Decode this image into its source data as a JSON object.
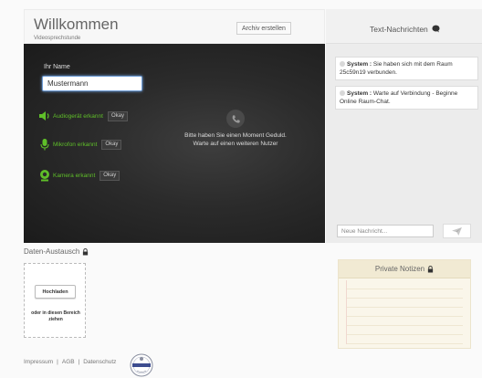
{
  "header": {
    "title": "Willkommen",
    "subtitle": "Videosprechstunde",
    "archive_label": "Archiv erstellen"
  },
  "setup": {
    "name_label": "Ihr Name",
    "name_value": "Mustermann",
    "checks": [
      {
        "icon": "speaker-icon",
        "label": "Audiogerät erkannt",
        "button": "Okay"
      },
      {
        "icon": "microphone-icon",
        "label": "Mikrofon erkannt",
        "button": "Okay"
      },
      {
        "icon": "webcam-icon",
        "label": "Kamera erkannt",
        "button": "Okay"
      }
    ],
    "wait_line1": "Bitte haben Sie einen Moment Geduld.",
    "wait_line2": "Warte auf einen weiteren Nutzer"
  },
  "chat": {
    "title": "Text-Nachrichten",
    "messages": [
      {
        "sender": "System :",
        "text": " Sie haben sich mit dem Raum 25c59n19 verbunden."
      },
      {
        "sender": "System :",
        "text": " Warte auf Verbindung - Beginne Online Raum-Chat."
      }
    ],
    "input_placeholder": "Neue Nachricht..."
  },
  "data_exchange": {
    "title": "Daten-Austausch",
    "upload_label": "Hochladen",
    "drop_text": "oder in diesen Bereich ziehen"
  },
  "notes": {
    "title": "Private Notizen"
  },
  "footer": {
    "links": [
      "Impressum",
      "AGB",
      "Datenschutz"
    ],
    "separator": "|"
  },
  "colors": {
    "accent_green": "#5fbf29",
    "video_bg": "#2b2b2b",
    "input_focus": "#6f9dd6"
  }
}
